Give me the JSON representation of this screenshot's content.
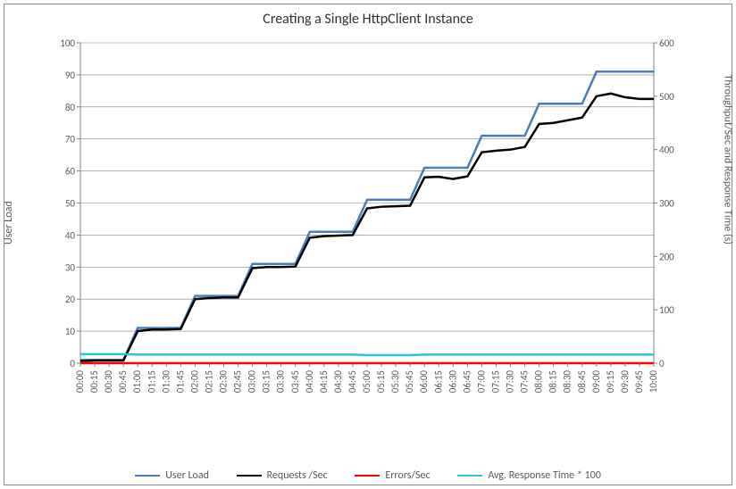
{
  "chart_data": {
    "type": "line",
    "title": "Creating a Single HttpClient Instance",
    "x_categories": [
      "00:00",
      "00:15",
      "00:30",
      "00:45",
      "01:00",
      "01:15",
      "01:30",
      "01:45",
      "02:00",
      "02:15",
      "02:30",
      "02:45",
      "03:00",
      "03:15",
      "03:30",
      "03:45",
      "04:00",
      "04:15",
      "04:30",
      "04:45",
      "05:00",
      "05:15",
      "05:30",
      "05:45",
      "06:00",
      "06:15",
      "06:30",
      "06:45",
      "07:00",
      "07:15",
      "07:30",
      "07:45",
      "08:00",
      "08:15",
      "08:30",
      "08:45",
      "09:00",
      "09:15",
      "09:30",
      "09:45",
      "10:00"
    ],
    "y_left": {
      "label": "User Load",
      "min": 0,
      "max": 100,
      "step": 10
    },
    "y_right": {
      "label": "Throughput/Sec and Response Time (s)",
      "min": 0,
      "max": 600,
      "step": 100
    },
    "series": [
      {
        "name": "User Load",
        "axis": "left",
        "color": "#4A7EBB",
        "values": [
          1,
          1,
          1,
          1,
          11,
          11,
          11,
          11,
          21,
          21,
          21,
          21,
          31,
          31,
          31,
          31,
          41,
          41,
          41,
          41,
          51,
          51,
          51,
          51,
          61,
          61,
          61,
          61,
          71,
          71,
          71,
          71,
          81,
          81,
          81,
          81,
          91,
          91,
          91,
          91,
          91
        ]
      },
      {
        "name": "Requests /Sec",
        "axis": "right",
        "color": "#000000",
        "values": [
          4,
          5,
          5,
          5,
          60,
          63,
          63,
          64,
          120,
          122,
          123,
          123,
          178,
          180,
          180,
          181,
          235,
          238,
          239,
          240,
          290,
          293,
          294,
          295,
          348,
          349,
          345,
          350,
          395,
          398,
          400,
          405,
          448,
          450,
          455,
          460,
          500,
          505,
          498,
          495,
          495
        ]
      },
      {
        "name": "Errors/Sec",
        "axis": "right",
        "color": "#FF0000",
        "values": [
          0,
          0,
          0,
          0,
          0,
          0,
          0,
          0,
          0,
          0,
          0,
          0,
          0,
          0,
          0,
          0,
          0,
          0,
          0,
          0,
          0,
          0,
          0,
          0,
          0,
          0,
          0,
          0,
          0,
          0,
          0,
          0,
          0,
          0,
          0,
          0,
          0,
          0,
          0,
          0,
          0
        ]
      },
      {
        "name": "Avg. Response Time * 100",
        "axis": "right",
        "color": "#26C6DA",
        "values": [
          17,
          17,
          17,
          17,
          16,
          16,
          16,
          16,
          16,
          16,
          16,
          16,
          16,
          16,
          16,
          16,
          16,
          16,
          16,
          16,
          15,
          15,
          15,
          15,
          16,
          16,
          16,
          16,
          16,
          16,
          16,
          16,
          16,
          16,
          16,
          16,
          16,
          16,
          16,
          16,
          16
        ]
      }
    ],
    "legend_position": "bottom",
    "grid": true
  }
}
